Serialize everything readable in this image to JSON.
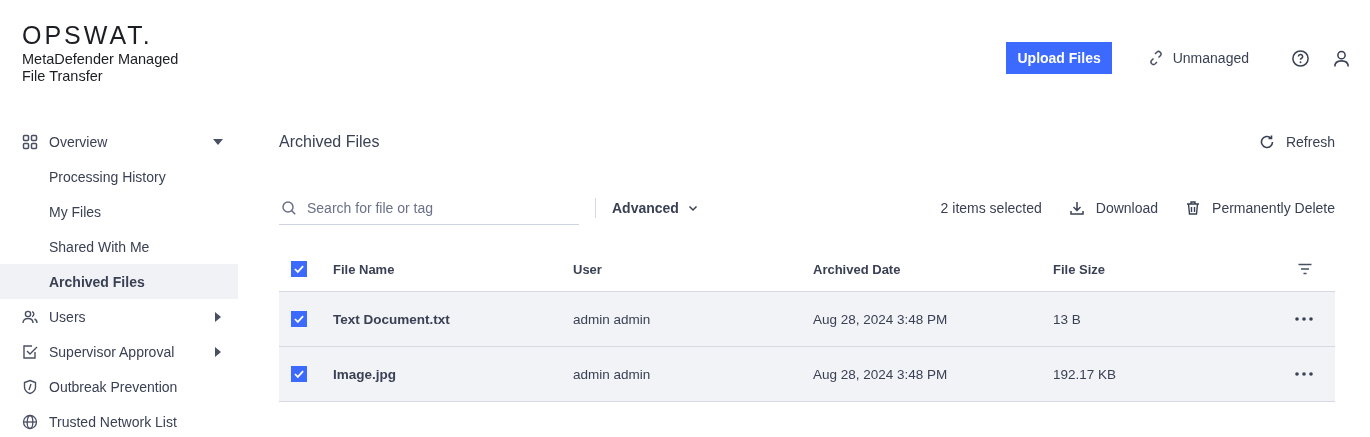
{
  "brand": {
    "logo": "OPSWAT.",
    "product": "MetaDefender Managed File Transfer"
  },
  "header": {
    "upload_button": "Upload Files",
    "status_link": "Unmanaged"
  },
  "sidebar": {
    "items": [
      {
        "label": "Overview",
        "selected": false,
        "expanded": true,
        "children": [
          {
            "label": "Processing History",
            "selected": false
          },
          {
            "label": "My Files",
            "selected": false
          },
          {
            "label": "Shared With Me",
            "selected": false
          },
          {
            "label": "Archived Files",
            "selected": true
          }
        ]
      },
      {
        "label": "Users",
        "selected": false,
        "expanded": false
      },
      {
        "label": "Supervisor Approval",
        "selected": false,
        "expanded": false
      },
      {
        "label": "Outbreak Prevention",
        "selected": false
      },
      {
        "label": "Trusted Network List",
        "selected": false
      }
    ]
  },
  "page": {
    "title": "Archived Files",
    "refresh": "Refresh"
  },
  "toolbar": {
    "search": {
      "placeholder": "Search for file or tag"
    },
    "advanced": "Advanced",
    "selection_count": "2 items selected",
    "download": "Download",
    "delete": "Permanently Delete"
  },
  "table": {
    "select_all_checked": true,
    "columns": [
      "File Name",
      "User",
      "Archived Date",
      "File Size"
    ],
    "rows": [
      {
        "checked": true,
        "name": "Text Document.txt",
        "user": "admin admin",
        "date": "Aug 28, 2024 3:48 PM",
        "size": "13 B"
      },
      {
        "checked": true,
        "name": "Image.jpg",
        "user": "admin admin",
        "date": "Aug 28, 2024 3:48 PM",
        "size": "192.17 KB"
      }
    ]
  }
}
